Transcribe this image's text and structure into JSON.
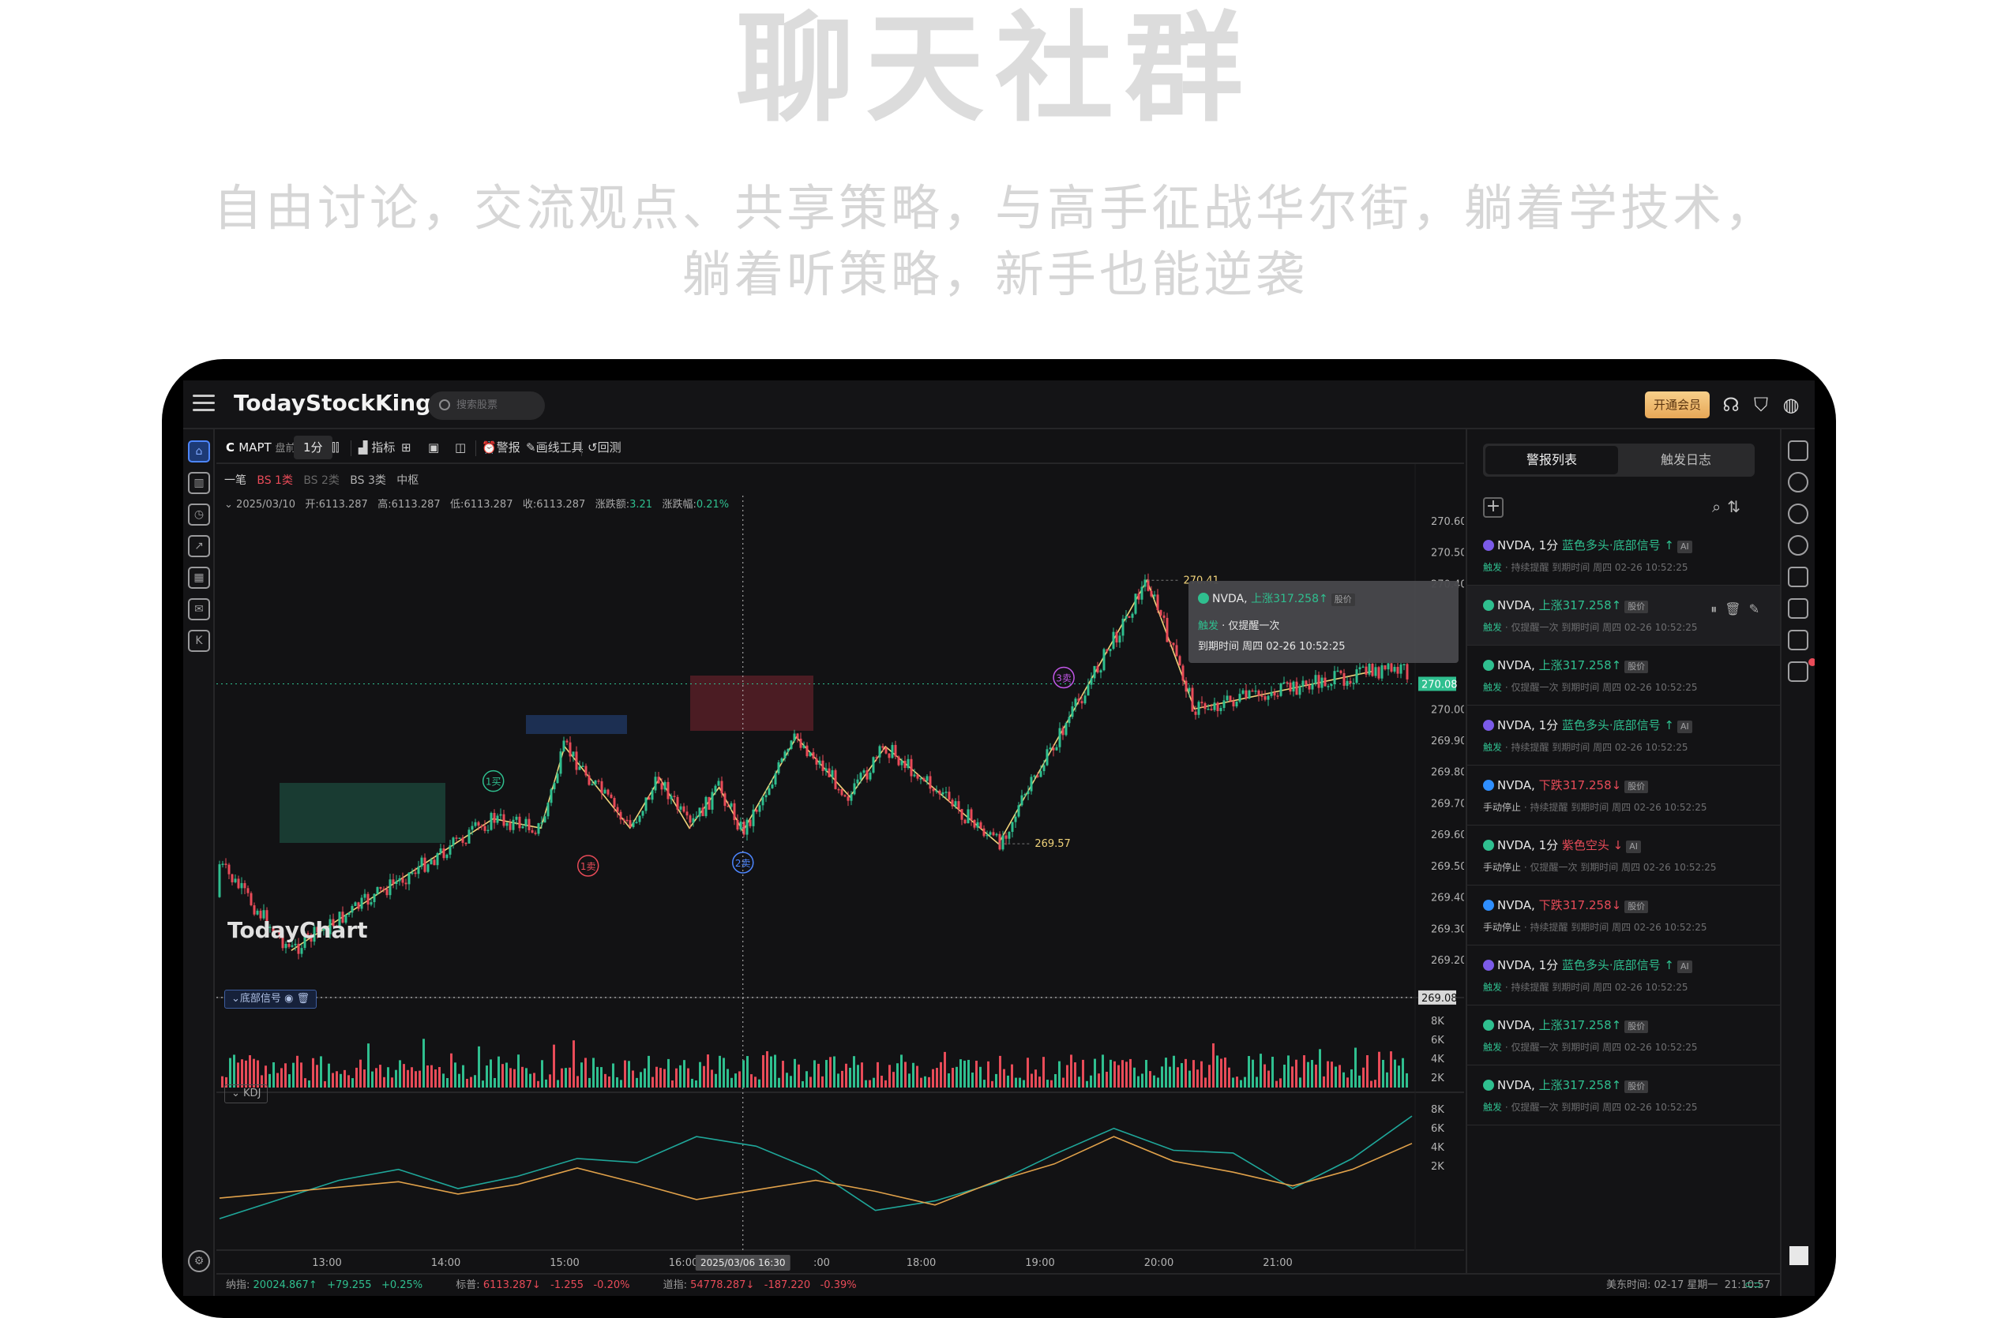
{
  "hero": {
    "title": "聊天社群",
    "subtitle_line1": "自由讨论，交流观点、共享策略，与高手征战华尔街，躺着学技术，",
    "subtitle_line2": "躺着听策略，新手也能逆袭"
  },
  "app": {
    "logo": "TodayStockKing",
    "search_placeholder": "搜索股票",
    "vip_label": "开通会员",
    "watermark": "TodayChart"
  },
  "toolbar": {
    "symbol": "MAPT",
    "session": "盘前",
    "interval": "1分",
    "indicators": "指标",
    "alert": "警报",
    "drawing": "画线工具",
    "backtest": "回测"
  },
  "subbar": {
    "items": [
      "一笔",
      "BS 1类",
      "BS 2类",
      "BS 3类",
      "中枢"
    ]
  },
  "ohlc": {
    "date": "2025/03/10",
    "open_label": "开:",
    "open": "6113.287",
    "high_label": "高:",
    "high": "6113.287",
    "low_label": "低:",
    "low": "6113.287",
    "close_label": "收:",
    "close": "6113.287",
    "chg_label": "涨跌额:",
    "chg": "3.21",
    "pct_label": "涨跌幅:",
    "pct": "0.21%"
  },
  "chart_data": {
    "type": "line",
    "title": "",
    "xlabel": "",
    "ylabel": "",
    "ylim": [
      269.1,
      270.65
    ],
    "y_ticks": [
      "270.60",
      "270.50",
      "270.40",
      "270.00",
      "269.90",
      "269.80",
      "269.70",
      "269.60",
      "269.50",
      "269.40",
      "269.30",
      "269.20"
    ],
    "x_ticks": [
      "13:00",
      "14:00",
      "15:00",
      "16:00",
      "17:00",
      "18:00",
      "19:00",
      "20:00",
      "21:00"
    ],
    "crosshair_time": "2025/03/06 16:30",
    "price_labels": {
      "current": "270.08",
      "line": "269.08"
    },
    "peak_label": "270.41",
    "trough_label": "269.57",
    "signals": [
      "1买",
      "1卖",
      "2卖",
      "3卖"
    ],
    "zigzag": [
      {
        "x": 12.7,
        "y": 269.23
      },
      {
        "x": 14.4,
        "y": 269.65
      },
      {
        "x": 14.8,
        "y": 269.62
      },
      {
        "x": 15.0,
        "y": 269.88
      },
      {
        "x": 15.55,
        "y": 269.62
      },
      {
        "x": 15.8,
        "y": 269.78
      },
      {
        "x": 16.05,
        "y": 269.62
      },
      {
        "x": 16.3,
        "y": 269.75
      },
      {
        "x": 16.5,
        "y": 269.61
      },
      {
        "x": 16.95,
        "y": 269.91
      },
      {
        "x": 17.4,
        "y": 269.72
      },
      {
        "x": 17.7,
        "y": 269.88
      },
      {
        "x": 18.65,
        "y": 269.57
      },
      {
        "x": 19.9,
        "y": 270.41
      },
      {
        "x": 20.3,
        "y": 270.0
      },
      {
        "x": 21.8,
        "y": 270.12
      }
    ],
    "volume_pane": {
      "label": "底部信号",
      "y_ticks": [
        "8K",
        "6K",
        "4K",
        "2K"
      ]
    },
    "kdj_pane": {
      "label": "KDJ",
      "y_ticks": [
        "8K",
        "6K",
        "4K",
        "2K"
      ],
      "series": [
        {
          "values": [
            0.8,
            2.2,
            3.6,
            4.4,
            3.0,
            3.9,
            5.2,
            4.9,
            6.8,
            6.1,
            4.3,
            1.4,
            2.1,
            3.4,
            5.5,
            7.4,
            5.8,
            5.6,
            3.0,
            5.2,
            8.3
          ]
        },
        {
          "values": [
            2.3,
            2.7,
            3.1,
            3.5,
            2.6,
            3.3,
            4.5,
            3.4,
            2.2,
            2.9,
            3.6,
            2.8,
            1.8,
            3.5,
            4.8,
            6.8,
            5.0,
            4.2,
            3.2,
            4.4,
            6.3
          ]
        }
      ]
    }
  },
  "tooltip": {
    "symbol": "NVDA,",
    "cond": "上涨317.258↑",
    "tag": "股价",
    "line2": "仅提醒一次",
    "line2_prefix": "触发",
    "line3": "到期时间 周四 02-26 10:52:25"
  },
  "status": {
    "nasdaq_label": "纳指:",
    "nasdaq_value": "20024.867↑",
    "nasdaq_chg": "+79.255",
    "nasdaq_pct": "+0.25%",
    "sp_label": "标普:",
    "sp_value": "6113.287↓",
    "sp_chg": "-1.255",
    "sp_pct": "-0.20%",
    "dow_label": "道指:",
    "dow_value": "54778.287↓",
    "dow_chg": "-187.220",
    "dow_pct": "-0.39%",
    "time_label": "美东时间: 02-17 星期一",
    "time_value": "21:10:57"
  },
  "panel": {
    "tab_alerts": "警报列表",
    "tab_log": "触发日志",
    "alerts": [
      {
        "sym": "NVDA,",
        "pre": "1分",
        "cond": "蓝色多头·底部信号 ↑",
        "cond_color": "g",
        "tag": "AI",
        "dot": "#7b5be8",
        "trig": "触发",
        "trig_color": "g",
        "rest": "· 持续提醒 到期时间 周四 02-26 10:52:25"
      },
      {
        "sym": "NVDA,",
        "pre": "",
        "cond": "上涨317.258↑",
        "cond_color": "g",
        "tag": "股价",
        "dot": "#2fbf8f",
        "trig": "触发",
        "trig_color": "g",
        "rest": "· 仅提醒一次 到期时间 周四 02-26 10:52:25"
      },
      {
        "sym": "NVDA,",
        "pre": "",
        "cond": "上涨317.258↑",
        "cond_color": "g",
        "tag": "股价",
        "dot": "#2fbf8f",
        "trig": "触发",
        "trig_color": "g",
        "rest": "· 仅提醒一次 到期时间 周四 02-26 10:52:25"
      },
      {
        "sym": "NVDA,",
        "pre": "1分",
        "cond": "蓝色多头·底部信号 ↑",
        "cond_color": "g",
        "tag": "AI",
        "dot": "#7b5be8",
        "trig": "触发",
        "trig_color": "g",
        "rest": "· 持续提醒 到期时间 周四 02-26 10:52:25"
      },
      {
        "sym": "NVDA,",
        "pre": "",
        "cond": "下跌317.258↓",
        "cond_color": "r",
        "tag": "股价",
        "dot": "#2f8fff",
        "trig": "手动停止",
        "trig_color": "w",
        "rest": "· 持续提醒 到期时间 周四 02-26 10:52:25"
      },
      {
        "sym": "NVDA,",
        "pre": "1分",
        "cond": "紫色空头 ↓",
        "cond_color": "r",
        "tag": "AI",
        "dot": "#2fbf8f",
        "trig": "手动停止",
        "trig_color": "w",
        "rest": "· 仅提醒一次 到期时间 周四 02-26 10:52:25"
      },
      {
        "sym": "NVDA,",
        "pre": "",
        "cond": "下跌317.258↓",
        "cond_color": "r",
        "tag": "股价",
        "dot": "#2f8fff",
        "trig": "手动停止",
        "trig_color": "w",
        "rest": "· 持续提醒 到期时间 周四 02-26 10:52:25"
      },
      {
        "sym": "NVDA,",
        "pre": "1分",
        "cond": "蓝色多头·底部信号 ↑",
        "cond_color": "g",
        "tag": "AI",
        "dot": "#7b5be8",
        "trig": "触发",
        "trig_color": "g",
        "rest": "· 持续提醒 到期时间 周四 02-26 10:52:25"
      },
      {
        "sym": "NVDA,",
        "pre": "",
        "cond": "上涨317.258↑",
        "cond_color": "g",
        "tag": "股价",
        "dot": "#2fbf8f",
        "trig": "触发",
        "trig_color": "g",
        "rest": "· 仅提醒一次 到期时间 周四 02-26 10:52:25"
      },
      {
        "sym": "NVDA,",
        "pre": "",
        "cond": "上涨317.258↑",
        "cond_color": "g",
        "tag": "股价",
        "dot": "#2fbf8f",
        "trig": "触发",
        "trig_color": "g",
        "rest": "· 仅提醒一次 到期时间 周四 02-26 10:52:25"
      }
    ]
  },
  "colors": {
    "up": "#2fbf8f",
    "down": "#e84b58",
    "zigzag": "#f0d27a",
    "accent": "#4d86ff"
  }
}
